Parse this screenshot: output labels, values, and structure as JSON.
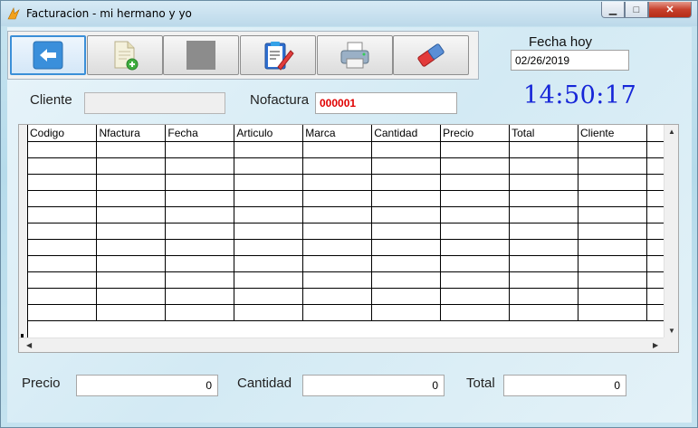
{
  "window": {
    "title": "Facturacion - mi hermano y yo",
    "min_glyph": "▁",
    "max_glyph": "□",
    "close_glyph": "✕"
  },
  "toolbar": {
    "buttons": [
      {
        "name": "back-button",
        "icon": "arrow-left-icon"
      },
      {
        "name": "new-document-button",
        "icon": "new-document-icon"
      },
      {
        "name": "stop-button",
        "icon": "stop-icon"
      },
      {
        "name": "edit-button",
        "icon": "edit-clipboard-icon"
      },
      {
        "name": "print-button",
        "icon": "printer-icon"
      },
      {
        "name": "erase-button",
        "icon": "eraser-icon"
      }
    ]
  },
  "header": {
    "fecha_label": "Fecha hoy",
    "fecha_value": "02/26/2019",
    "clock": "14:50:17"
  },
  "form": {
    "cliente_label": "Cliente",
    "cliente_value": "",
    "nofactura_label": "Nofactura",
    "nofactura_value": "000001"
  },
  "grid": {
    "columns": [
      "Codigo",
      "Nfactura",
      "Fecha",
      "Articulo",
      "Marca",
      "Cantidad",
      "Precio",
      "Total",
      "Cliente",
      ""
    ],
    "row_count": 11
  },
  "totals": {
    "precio_label": "Precio",
    "precio_value": "0",
    "cantidad_label": "Cantidad",
    "cantidad_value": "0",
    "total_label": "Total",
    "total_value": "0"
  },
  "colors": {
    "clock": "#1626d8",
    "nofactura": "#e00000",
    "active_button_border": "#3b8fd8"
  }
}
